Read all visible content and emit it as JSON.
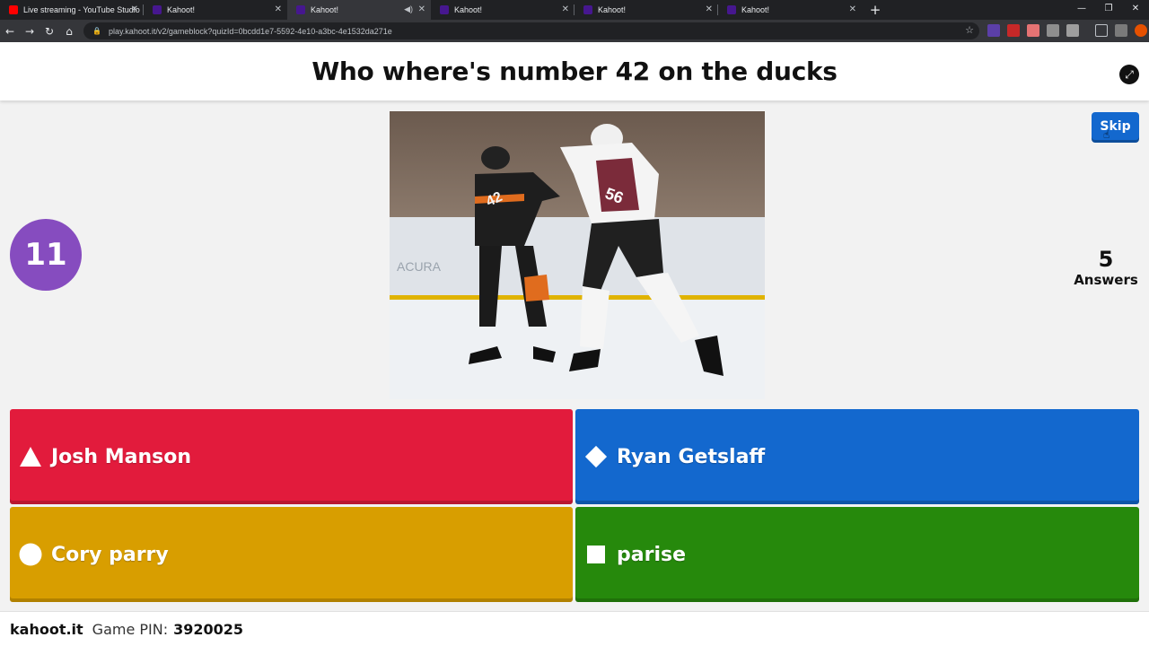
{
  "browser": {
    "tabs": [
      {
        "title": "Live streaming - YouTube Studio",
        "favicon": "youtube-icon",
        "active": false
      },
      {
        "title": "Kahoot!",
        "favicon": "kahoot-icon",
        "active": false
      },
      {
        "title": "Kahoot!",
        "favicon": "kahoot-icon",
        "active": true
      },
      {
        "title": "Kahoot!",
        "favicon": "kahoot-icon",
        "active": false
      },
      {
        "title": "Kahoot!",
        "favicon": "kahoot-icon",
        "active": false
      },
      {
        "title": "Kahoot!",
        "favicon": "kahoot-icon",
        "active": false
      }
    ],
    "url": "play.kahoot.it/v2/gameblock?quizId=0bcdd1e7-5592-4e10-a3bc-4e1532da271e"
  },
  "game": {
    "question": "Who where's number 42 on the ducks",
    "timer": "11",
    "skip_label": "Skip",
    "answers_count": "5",
    "answers_label": "Answers",
    "answers": [
      {
        "text": "Josh Manson",
        "shape": "triangle-icon",
        "color": "#e21b3c"
      },
      {
        "text": "Ryan Getslaff",
        "shape": "diamond-icon",
        "color": "#1368ce"
      },
      {
        "text": "Cory parry",
        "shape": "circle-icon",
        "color": "#d89e00"
      },
      {
        "text": "parise",
        "shape": "square-icon",
        "color": "#26890c"
      }
    ]
  },
  "footer": {
    "brand": "kahoot.it",
    "pin_label": "Game PIN:",
    "pin": "3920025"
  },
  "colors": {
    "timer": "#864cbf",
    "skip": "#1368ce"
  }
}
